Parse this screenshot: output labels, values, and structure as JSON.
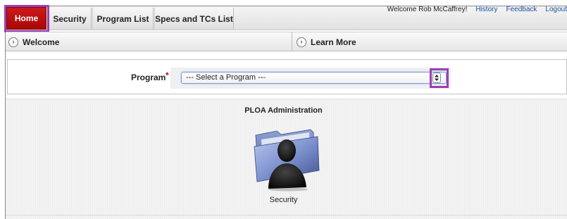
{
  "header": {
    "welcome": "Welcome Rob McCaffrey!",
    "links": [
      "History",
      "Feedback",
      "Logout"
    ]
  },
  "tabs": {
    "home": "Home",
    "security": "Security",
    "program_list": "Program List",
    "specs": "Specs and TCs List"
  },
  "sections": {
    "welcome": "Welcome",
    "learn_more": "Learn More"
  },
  "program": {
    "label": "Program",
    "required_marker": "*",
    "selected_value": "--- Select a Program ---"
  },
  "admin": {
    "title": "PLOA Administration",
    "item_label": "Security"
  },
  "colors": {
    "home_tab": "#b50f0f",
    "highlight": "#9a3fb3",
    "link": "#1c4fa3"
  },
  "icons": {
    "section_toggle": "chevron-right-icon",
    "select_arrows": "up-down-arrows-icon",
    "security_folder": "user-folder-icon"
  }
}
